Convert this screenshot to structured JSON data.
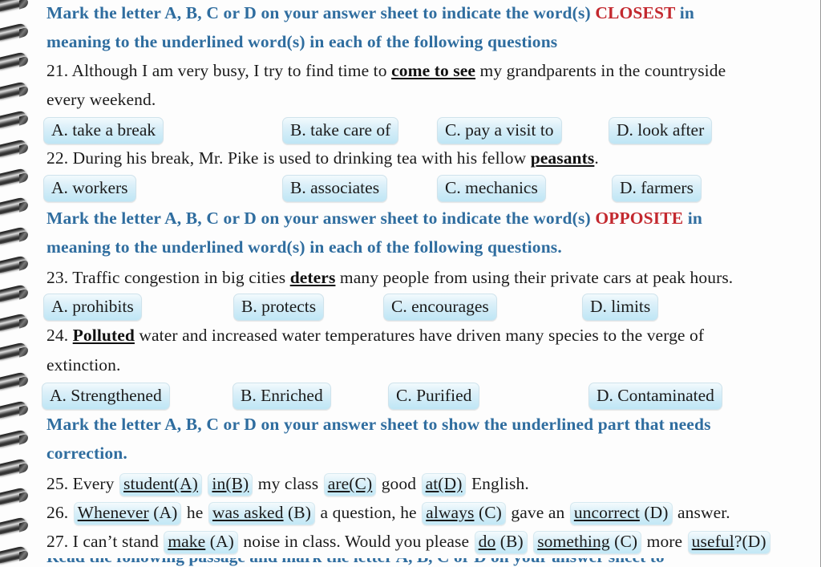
{
  "document": {
    "type": "spiral-bound-workbook-page",
    "background_color": "#fdfdfd",
    "instruction_color": "#2f6d9f",
    "keyword_color": "#c3282e",
    "option_box_color": "#c3e8f6"
  },
  "instructions": [
    {
      "id": "instruction-closest",
      "line1_pre": "Mark the letter A, B, C or D on your answer sheet to indicate the word(s) ",
      "keyword": "CLOSEST",
      "line1_post": " in",
      "line2": "meaning to the underlined word(s) in each of the following questions"
    },
    {
      "id": "instruction-opposite",
      "line1_pre": "Mark the letter A, B, C or D on your answer sheet to indicate the word(s) ",
      "keyword": "OPPOSITE",
      "line1_post": " in",
      "line2": "meaning to the underlined word(s) in each of the following questions."
    },
    {
      "id": "instruction-correction",
      "line1": "Mark the letter A, B, C or D on your answer sheet to show the underlined part that needs",
      "line2": "correction."
    }
  ],
  "questions": [
    {
      "number": "21.",
      "stem_line1_pre": " Although I am very busy, I try to find time to ",
      "stem_underlined": "come to see",
      "stem_line1_post": " my grandparents in the countryside",
      "stem_line2": "every weekend.",
      "options": [
        {
          "label": "A. take a break"
        },
        {
          "label": "B. take care of"
        },
        {
          "label": "C. pay a visit to"
        },
        {
          "label": "D. look after"
        }
      ]
    },
    {
      "number": "22.",
      "stem_line1_pre": " During his break, Mr. Pike is used to drinking tea with his fellow ",
      "stem_underlined": "peasants",
      "stem_line1_post": ".",
      "options": [
        {
          "label": "A. workers"
        },
        {
          "label": "B. associates"
        },
        {
          "label": "C. mechanics"
        },
        {
          "label": "D. farmers"
        }
      ]
    },
    {
      "number": "23.",
      "stem_line1_pre": " Traffic congestion in big cities ",
      "stem_underlined": "deters",
      "stem_line1_post": " many people from using their private cars at peak hours.",
      "options": [
        {
          "label": "A. prohibits"
        },
        {
          "label": "B. protects"
        },
        {
          "label": "C. encourages"
        },
        {
          "label": "D. limits"
        }
      ]
    },
    {
      "number": "24.",
      "stem_underlined": "Polluted",
      "stem_line1_post": " water and increased water temperatures have driven many species to the verge of",
      "stem_line2": "extinction.",
      "options": [
        {
          "label": "A. Strengthened"
        },
        {
          "label": "B. Enriched"
        },
        {
          "label": "C. Purified"
        },
        {
          "label": "D. Contaminated"
        }
      ]
    },
    {
      "number": "25.",
      "parts": [
        {
          "kind": "text",
          "text": " Every "
        },
        {
          "kind": "chunk",
          "underlined": "student(A)",
          "plain": ""
        },
        {
          "kind": "text",
          "text": " "
        },
        {
          "kind": "chunk",
          "underlined": "in(B)",
          "plain": ""
        },
        {
          "kind": "text",
          "text": " my class "
        },
        {
          "kind": "chunk",
          "underlined": "are(C)",
          "plain": ""
        },
        {
          "kind": "text",
          "text": " good "
        },
        {
          "kind": "chunk",
          "underlined": "at(D)",
          "plain": ""
        },
        {
          "kind": "text",
          "text": " English."
        }
      ]
    },
    {
      "number": "26.",
      "parts": [
        {
          "kind": "text",
          "text": " "
        },
        {
          "kind": "chunk",
          "underlined": "Whenever",
          "plain": " (A)"
        },
        {
          "kind": "text",
          "text": " he "
        },
        {
          "kind": "chunk",
          "underlined": "was asked",
          "plain": " (B)"
        },
        {
          "kind": "text",
          "text": " a question, he "
        },
        {
          "kind": "chunk",
          "underlined": "always",
          "plain": " (C)"
        },
        {
          "kind": "text",
          "text": " gave an "
        },
        {
          "kind": "chunk",
          "underlined": "uncorrect",
          "plain": " (D)"
        },
        {
          "kind": "text",
          "text": " answer."
        }
      ]
    },
    {
      "number": "27.",
      "parts": [
        {
          "kind": "text",
          "text": " I can’t stand "
        },
        {
          "kind": "chunk",
          "underlined": "make",
          "plain": " (A)"
        },
        {
          "kind": "text",
          "text": " noise in class. Would you please "
        },
        {
          "kind": "chunk",
          "underlined": "do",
          "plain": " (B)"
        },
        {
          "kind": "text",
          "text": " "
        },
        {
          "kind": "chunk",
          "underlined": "something",
          "plain": " (C)"
        },
        {
          "kind": "text",
          "text": " more "
        },
        {
          "kind": "chunk",
          "underlined": "useful",
          "plain": "?(D)"
        }
      ]
    }
  ],
  "cut_off_line": {
    "text": "Read the following passage and mark the letter A, B, C or D on your answer sheet to"
  }
}
